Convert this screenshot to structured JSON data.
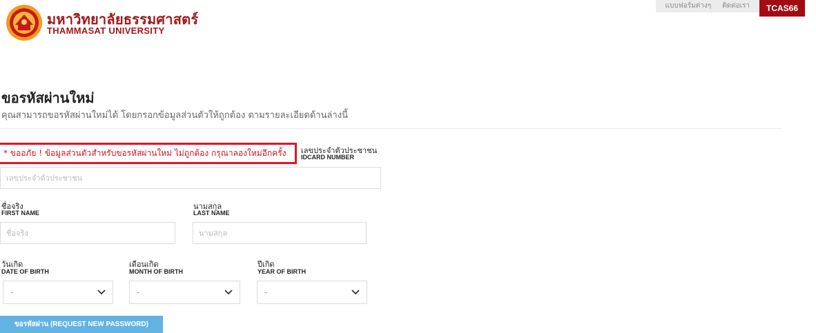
{
  "header": {
    "brand_th": "มหาวิทยาลัยธรรมศาสตร์",
    "brand_en": "THAMMASAT UNIVERSITY",
    "nav": [
      "แบบฟอร์มต่างๆ",
      "ติดต่อเรา"
    ],
    "tcas_label": "TCAS66",
    "accent_color": "#a30b13"
  },
  "page": {
    "title": "ขอรหัสผ่านใหม่",
    "subtitle": "คุณสามารถขอรหัสผ่านใหม่ได้ โดยกรอกข้อมูลส่วนตัวให้ถูกต้อง ตามรายละเอียดด้านล่างนี้"
  },
  "error": {
    "message": "* ขออภัย ! ข้อมูลส่วนตัวสำหรับขอรหัสผ่านใหม่ ไม่ถูกต้อง กรุณาลองใหม่อีกครั้ง",
    "color": "#d3131f"
  },
  "form": {
    "idcard": {
      "label_th": "เลขประจำตัวประชาชน",
      "label_en": "IDCARD NUMBER",
      "placeholder": "เลขประจำตัวประชาชน",
      "value": ""
    },
    "first_name": {
      "label_th": "ชื่อจริง",
      "label_en": "FIRST NAME",
      "placeholder": "ชื่อจริง",
      "value": ""
    },
    "last_name": {
      "label_th": "นามสกุล",
      "label_en": "LAST NAME",
      "placeholder": "นามสกุล",
      "value": ""
    },
    "day": {
      "label_th": "วันเกิด",
      "label_en": "DATE OF BIRTH",
      "selected": "-"
    },
    "month": {
      "label_th": "เดือนเกิด",
      "label_en": "MONTH OF BIRTH",
      "selected": "-"
    },
    "year": {
      "label_th": "ปีเกิด",
      "label_en": "YEAR OF BIRTH",
      "selected": "-"
    },
    "submit_label": "ขอรหัสผ่าน (REQUEST NEW PASSWORD)",
    "submit_color": "#63b3e2"
  }
}
